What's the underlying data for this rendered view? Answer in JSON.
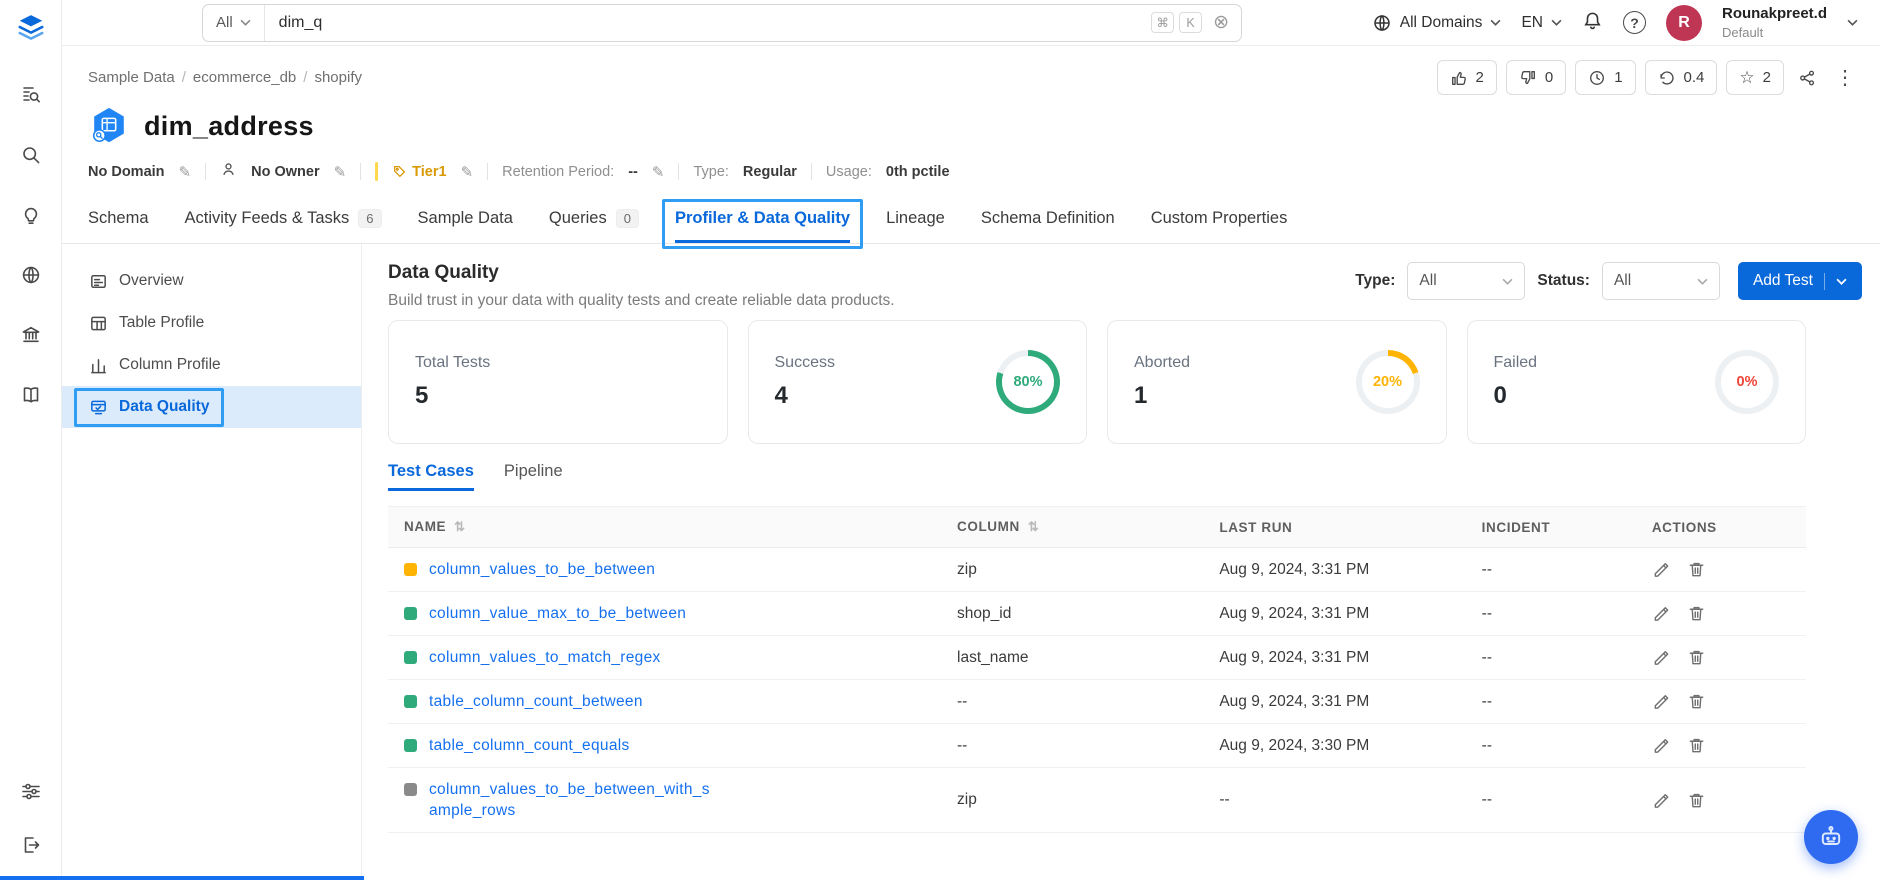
{
  "colors": {
    "accent": "#0968da",
    "link": "#1570ef",
    "highlight": "#2f9df4",
    "success": "#2eaa7b",
    "warning": "#ffb302",
    "error": "#f04438",
    "avatar_bg": "#bf3654"
  },
  "icons": {
    "edit": "✎",
    "clear": "⊗",
    "kebab": "⋮",
    "star": "☆",
    "sort": "⇅",
    "help": "?"
  },
  "topbar": {
    "search": {
      "scope": "All",
      "value": "dim_q",
      "shortcut_cmd": "⌘",
      "shortcut_key": "K"
    },
    "domains_label": "All Domains",
    "language": "EN",
    "user": {
      "initial": "R",
      "name": "Rounakpreet.d",
      "team": "Default"
    }
  },
  "breadcrumb": {
    "items": [
      "Sample Data",
      "ecommerce_db",
      "shopify"
    ],
    "separator": "/"
  },
  "header_actions": {
    "upvotes": "2",
    "downvotes": "0",
    "watch_count": "1",
    "version": "0.4",
    "stars": "2"
  },
  "entity": {
    "title": "dim_address",
    "domain": "No Domain",
    "owner": "No Owner",
    "tier": "Tier1",
    "retention_label": "Retention Period:",
    "retention_value": "--",
    "type_label": "Type:",
    "type_value": "Regular",
    "usage_label": "Usage:",
    "usage_value": "0th pctile"
  },
  "tabs": [
    {
      "label": "Schema"
    },
    {
      "label": "Activity Feeds & Tasks",
      "count": "6"
    },
    {
      "label": "Sample Data"
    },
    {
      "label": "Queries",
      "count": "0"
    },
    {
      "label": "Profiler & Data Quality"
    },
    {
      "label": "Lineage"
    },
    {
      "label": "Schema Definition"
    },
    {
      "label": "Custom Properties"
    }
  ],
  "subnav": [
    {
      "label": "Overview"
    },
    {
      "label": "Table Profile"
    },
    {
      "label": "Column Profile"
    },
    {
      "label": "Data Quality"
    }
  ],
  "quality": {
    "title": "Data Quality",
    "subtitle": "Build trust in your data with quality tests and create reliable data products.",
    "filters": {
      "type_label": "Type:",
      "type_value": "All",
      "status_label": "Status:",
      "status_value": "All"
    },
    "add_test_label": "Add Test",
    "cards": [
      {
        "label": "Total Tests",
        "value": "5"
      },
      {
        "label": "Success",
        "value": "4",
        "percent": 80,
        "percent_label": "80%",
        "color": "#2eaa7b"
      },
      {
        "label": "Aborted",
        "value": "1",
        "percent": 20,
        "percent_label": "20%",
        "color": "#ffb302"
      },
      {
        "label": "Failed",
        "value": "0",
        "percent": 0,
        "percent_label": "0%",
        "color": "#f04438"
      }
    ],
    "inner_tabs": [
      "Test Cases",
      "Pipeline"
    ],
    "table": {
      "headers": [
        "NAME",
        "COLUMN",
        "LAST RUN",
        "INCIDENT",
        "ACTIONS"
      ],
      "rows": [
        {
          "status_color": "#ffb302",
          "name": "column_values_to_be_between",
          "column": "zip",
          "last_run": "Aug 9, 2024, 3:31 PM",
          "incident": "--"
        },
        {
          "status_color": "#2eaa7b",
          "name": "column_value_max_to_be_between",
          "column": "shop_id",
          "last_run": "Aug 9, 2024, 3:31 PM",
          "incident": "--"
        },
        {
          "status_color": "#2eaa7b",
          "name": "column_values_to_match_regex",
          "column": "last_name",
          "last_run": "Aug 9, 2024, 3:31 PM",
          "incident": "--"
        },
        {
          "status_color": "#2eaa7b",
          "name": "table_column_count_between",
          "column": "--",
          "last_run": "Aug 9, 2024, 3:31 PM",
          "incident": "--"
        },
        {
          "status_color": "#2eaa7b",
          "name": "table_column_count_equals",
          "column": "--",
          "last_run": "Aug 9, 2024, 3:30 PM",
          "incident": "--"
        },
        {
          "status_color": "#8a8a8a",
          "name": "column_values_to_be_between_with_sample_rows",
          "column": "zip",
          "last_run": "--",
          "incident": "--"
        }
      ]
    }
  }
}
